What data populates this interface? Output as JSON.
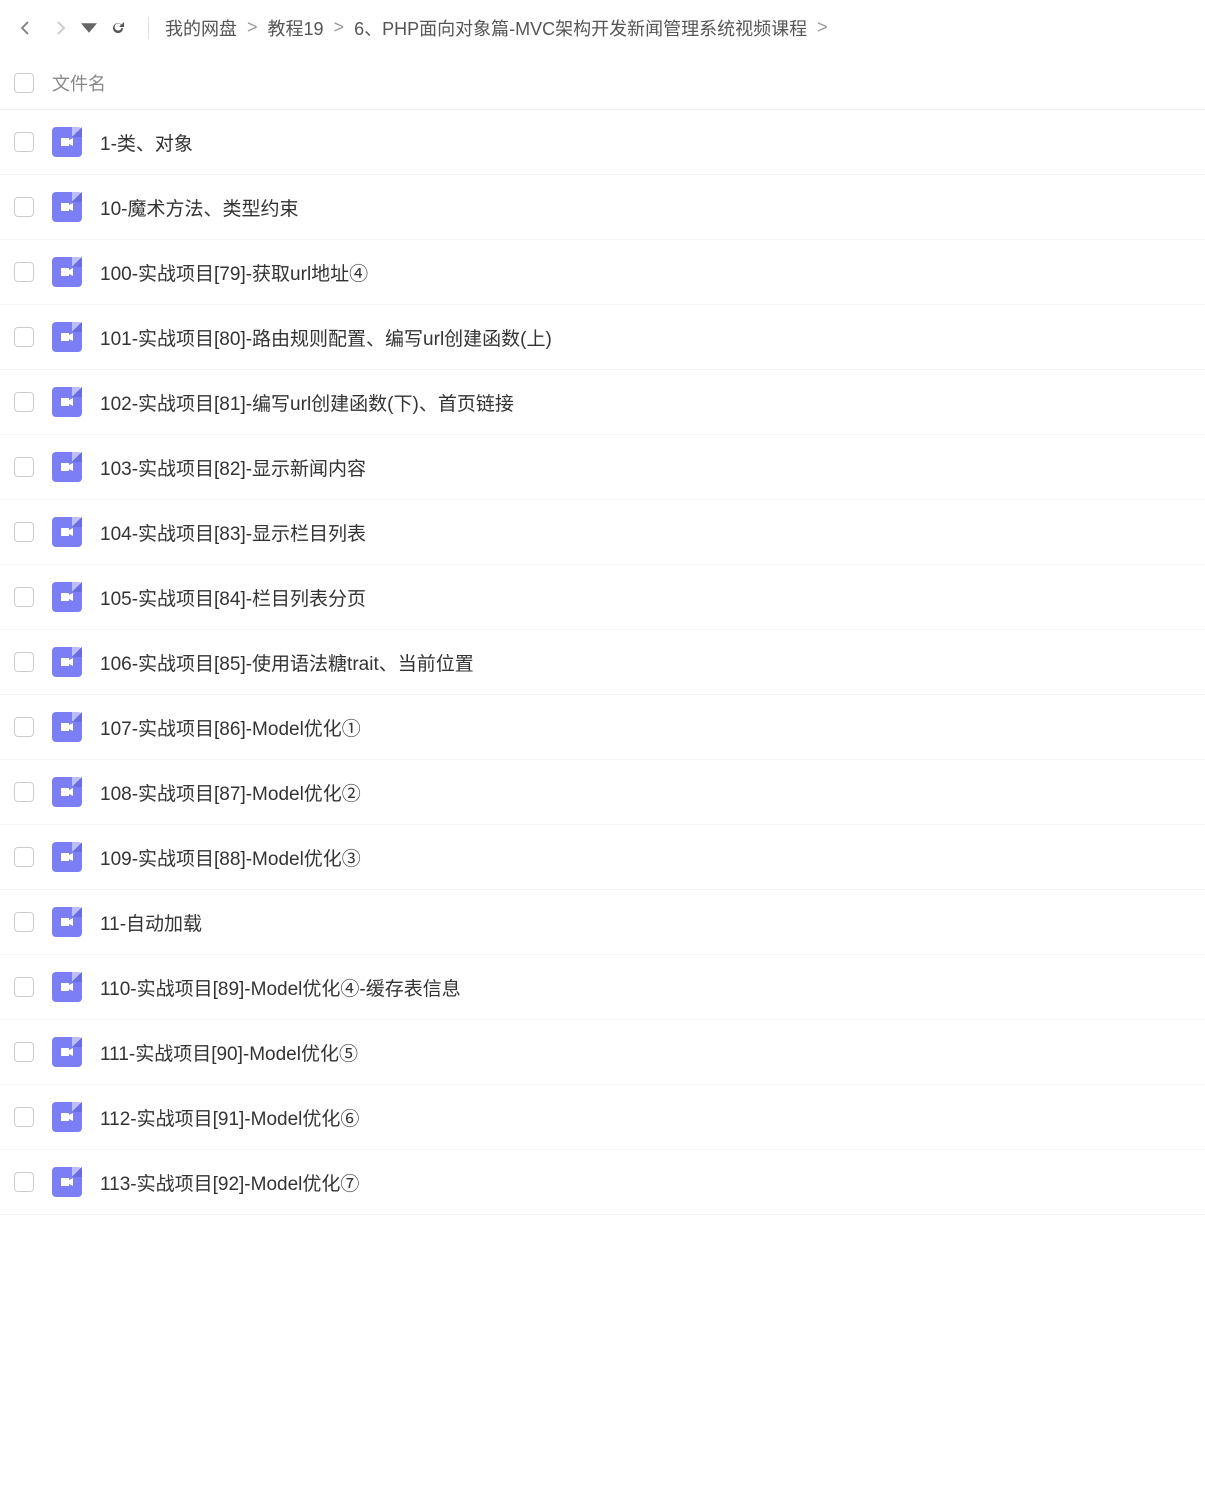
{
  "breadcrumb": {
    "items": [
      {
        "label": "我的网盘"
      },
      {
        "label": "教程19"
      },
      {
        "label": "6、PHP面向对象篇-MVC架构开发新闻管理系统视频课程"
      }
    ],
    "separator": ">"
  },
  "header": {
    "filename_label": "文件名"
  },
  "files": [
    {
      "name": "1-类、对象"
    },
    {
      "name": "10-魔术方法、类型约束"
    },
    {
      "name": "100-实战项目[79]-获取url地址④"
    },
    {
      "name": "101-实战项目[80]-路由规则配置、编写url创建函数(上)"
    },
    {
      "name": "102-实战项目[81]-编写url创建函数(下)、首页链接"
    },
    {
      "name": "103-实战项目[82]-显示新闻内容"
    },
    {
      "name": "104-实战项目[83]-显示栏目列表"
    },
    {
      "name": "105-实战项目[84]-栏目列表分页"
    },
    {
      "name": "106-实战项目[85]-使用语法糖trait、当前位置"
    },
    {
      "name": "107-实战项目[86]-Model优化①"
    },
    {
      "name": "108-实战项目[87]-Model优化②"
    },
    {
      "name": "109-实战项目[88]-Model优化③"
    },
    {
      "name": "11-自动加载"
    },
    {
      "name": "110-实战项目[89]-Model优化④-缓存表信息"
    },
    {
      "name": "111-实战项目[90]-Model优化⑤"
    },
    {
      "name": "112-实战项目[91]-Model优化⑥"
    },
    {
      "name": "113-实战项目[92]-Model优化⑦"
    }
  ]
}
